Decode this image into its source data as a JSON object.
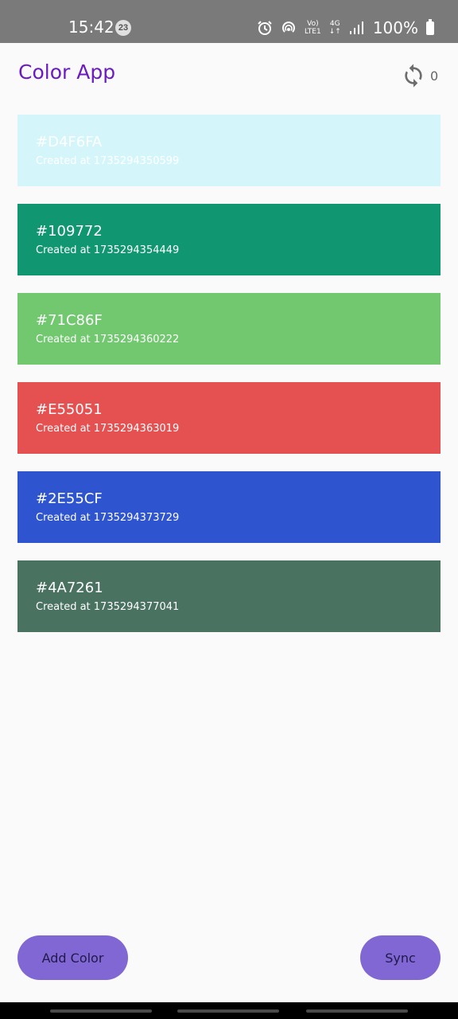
{
  "status_bar": {
    "time": "15:42",
    "notification_count": "23",
    "network_top": "Vo)",
    "network_bottom": "LTE1",
    "signal_gen": "4G",
    "battery": "100%"
  },
  "header": {
    "title": "Color App",
    "sync_count": "0"
  },
  "colors": [
    {
      "hex": "#D4F6FA",
      "created": "Created at 1735294350599",
      "bg": "#d4f6fa"
    },
    {
      "hex": "#109772",
      "created": "Created at 1735294354449",
      "bg": "#109772"
    },
    {
      "hex": "#71C86F",
      "created": "Created at 1735294360222",
      "bg": "#71c86f"
    },
    {
      "hex": "#E55051",
      "created": "Created at 1735294363019",
      "bg": "#e55051"
    },
    {
      "hex": "#2E55CF",
      "created": "Created at 1735294373729",
      "bg": "#2e55cf"
    },
    {
      "hex": "#4A7261",
      "created": "Created at 1735294377041",
      "bg": "#4a7261"
    }
  ],
  "actions": {
    "add_label": "Add Color",
    "sync_label": "Sync"
  },
  "theme": {
    "title_color": "#6a1cc0",
    "button_color": "#8067d3"
  }
}
